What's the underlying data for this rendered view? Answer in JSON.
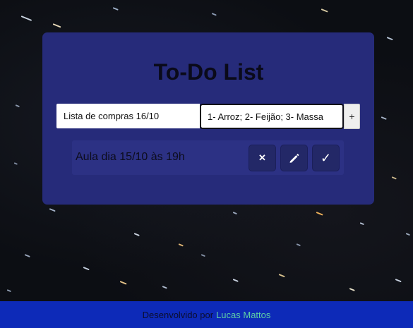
{
  "app": {
    "title": "To-Do List"
  },
  "form": {
    "task_input_value": "Lista de compras 16/10",
    "description_input_value": "1- Arroz; 2- Feijão; 3- Massa",
    "add_button_label": "+"
  },
  "tasks": [
    {
      "text": "Aula dia 15/10 às 19h",
      "actions": {
        "delete_label": "✕",
        "delete_icon": "close-icon",
        "edit_icon": "pencil-icon",
        "done_label": "✓",
        "done_icon": "check-icon"
      }
    }
  ],
  "footer": {
    "prefix": "Desenvolvido por",
    "author": "Lucas Mattos"
  },
  "colors": {
    "card": "#262b7a",
    "task_item": "#2c3184",
    "action_button": "#232867",
    "footer": "#0d2ab8",
    "author_link": "#5fd0a6"
  }
}
